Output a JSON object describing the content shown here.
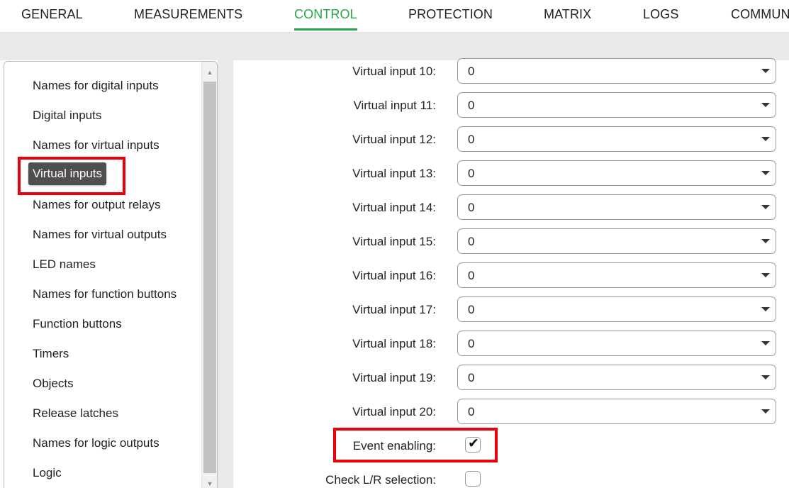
{
  "nav": {
    "tabs": [
      {
        "label": "GENERAL"
      },
      {
        "label": "MEASUREMENTS"
      },
      {
        "label": "CONTROL",
        "active": true
      },
      {
        "label": "PROTECTION"
      },
      {
        "label": "MATRIX"
      },
      {
        "label": "LOGS"
      },
      {
        "label": "COMMUN"
      }
    ],
    "active_color": "#27a844"
  },
  "sidebar": {
    "selected": "Virtual inputs",
    "items": [
      {
        "label": "Names for digital inputs"
      },
      {
        "label": "Digital inputs"
      },
      {
        "label": "Names for virtual inputs"
      },
      {
        "label": "Virtual inputs"
      },
      {
        "label": "Names for output relays"
      },
      {
        "label": "Names for virtual outputs"
      },
      {
        "label": "LED names"
      },
      {
        "label": "Names for function buttons"
      },
      {
        "label": "Function buttons"
      },
      {
        "label": "Timers"
      },
      {
        "label": "Objects"
      },
      {
        "label": "Release latches"
      },
      {
        "label": "Names for logic outputs"
      },
      {
        "label": "Logic"
      }
    ]
  },
  "form": {
    "rows": [
      {
        "label": "Virtual input 10:",
        "value": "0"
      },
      {
        "label": "Virtual input 11:",
        "value": "0"
      },
      {
        "label": "Virtual input 12:",
        "value": "0"
      },
      {
        "label": "Virtual input 13:",
        "value": "0"
      },
      {
        "label": "Virtual input 14:",
        "value": "0"
      },
      {
        "label": "Virtual input 15:",
        "value": "0"
      },
      {
        "label": "Virtual input 16:",
        "value": "0"
      },
      {
        "label": "Virtual input 17:",
        "value": "0"
      },
      {
        "label": "Virtual input 18:",
        "value": "0"
      },
      {
        "label": "Virtual input 19:",
        "value": "0"
      },
      {
        "label": "Virtual input 20:",
        "value": "0"
      }
    ],
    "event_enabling": {
      "label": "Event enabling:",
      "checked": true,
      "check_glyph": "✔"
    },
    "check_lr": {
      "label": "Check L/R selection:",
      "checked": false
    }
  },
  "highlight_color": "#e8000b",
  "icons": {
    "scroll_up": "▲",
    "scroll_down": "▼",
    "select_caret": "caret-down-icon"
  }
}
